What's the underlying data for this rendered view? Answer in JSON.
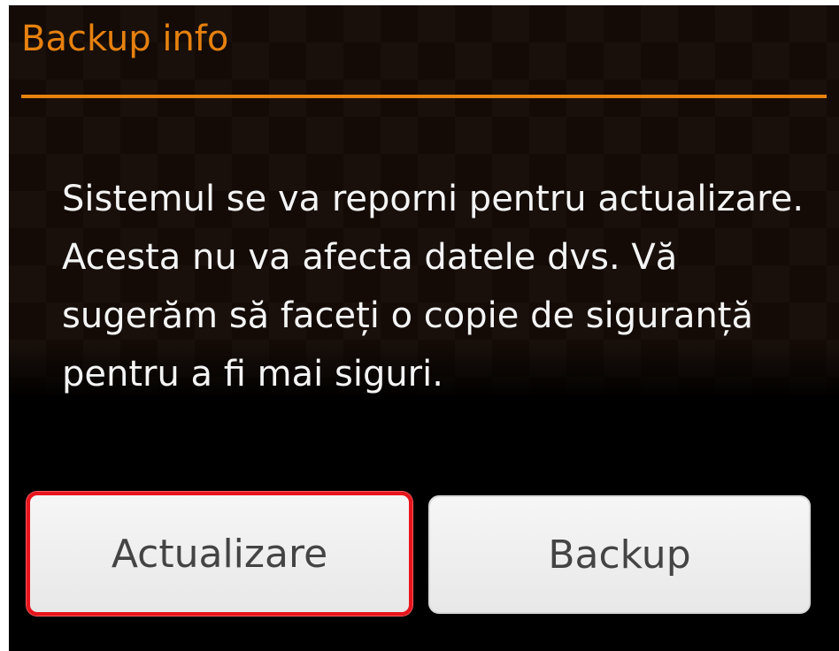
{
  "dialog": {
    "title": "Backup info",
    "message": "Sistemul se va reporni pentru actualizare. Acesta nu va afecta datele dvs. Vă sugerăm să faceți o copie de siguranță pentru a fi mai siguri.",
    "buttons": {
      "update_label": "Actualizare",
      "backup_label": "Backup"
    },
    "colors": {
      "title_accent": "#e6810f",
      "focus_border": "#e8141c",
      "background": "#000000",
      "message_text": "#f4f4f4"
    }
  }
}
